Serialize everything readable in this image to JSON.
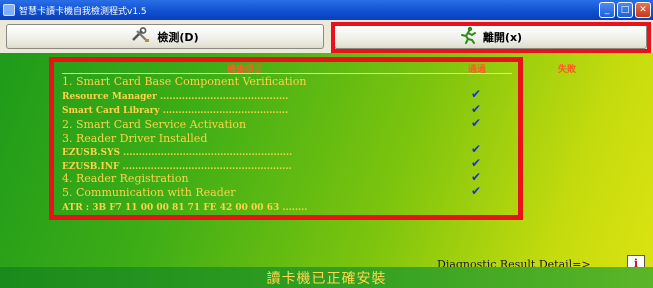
{
  "window": {
    "title": "智慧卡讀卡機自我檢測程式v1.5",
    "buttons": [
      "minimize",
      "maximize",
      "close"
    ]
  },
  "toolbar": {
    "detect_label": "檢測(D)",
    "detect_icon": "tools-icon",
    "exit_label": "離開(x)",
    "exit_icon": "running-man-icon"
  },
  "table": {
    "headers": {
      "item": "檢查項目",
      "pass": "通過",
      "fail": "失敗"
    },
    "rows": [
      {
        "text": "1. Smart Card Base Component Verification",
        "kind": "category",
        "check": false
      },
      {
        "text": "Resource Manager .........................................",
        "kind": "sub",
        "check": true
      },
      {
        "text": "Smart Card Library ........................................",
        "kind": "sub",
        "check": true
      },
      {
        "text": "2. Smart Card Service Activation",
        "kind": "category",
        "check": true
      },
      {
        "text": "3. Reader Driver Installed",
        "kind": "category",
        "check": false
      },
      {
        "text": "EZUSB.SYS ......................................................",
        "kind": "sub",
        "check": true
      },
      {
        "text": "EZUSB.INF ......................................................",
        "kind": "sub",
        "check": true
      },
      {
        "text": "4. Reader Registration",
        "kind": "category",
        "check": true
      },
      {
        "text": "5. Communication with Reader",
        "kind": "category",
        "check": true
      },
      {
        "text": "ATR : 3B F7 11 00 00 81 71 FE 42 00 00 63 ........",
        "kind": "sub",
        "check": false
      }
    ],
    "check_symbol": "✔"
  },
  "diagnostic": {
    "label": "Diagnostic Result Detail=>",
    "button_glyph": "i"
  },
  "status": "讀卡機已正確安裝",
  "colors": {
    "frame_red": "#e8121a",
    "text_gold": "#ffd34a",
    "check_blue": "#1b2fd8",
    "header_orange": "#ff5a26"
  }
}
